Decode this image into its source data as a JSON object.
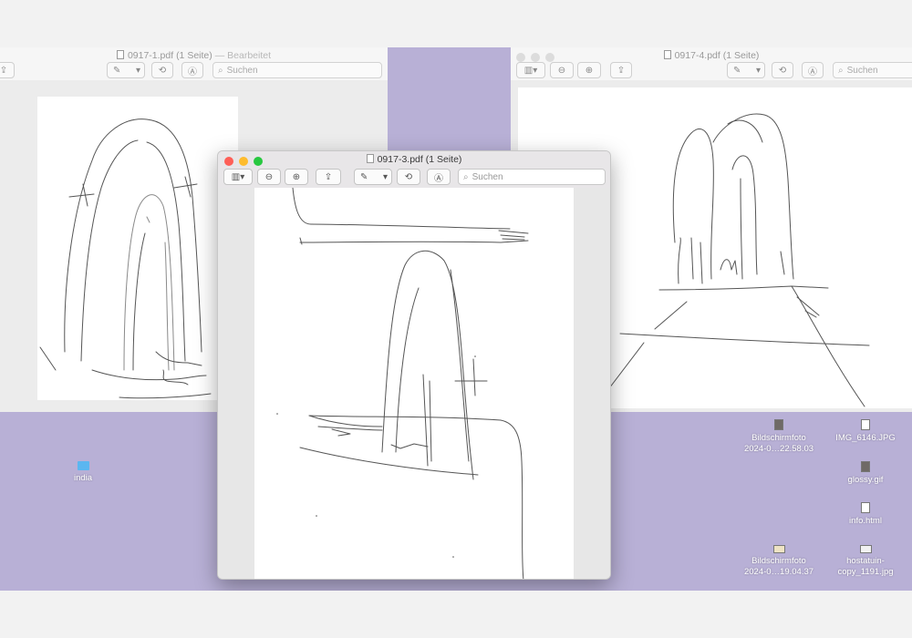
{
  "windows": {
    "left": {
      "title": "0917-1.pdf (1 Seite)",
      "title_suffix": "— Bearbeitet",
      "search_placeholder": "Suchen"
    },
    "right": {
      "title": "0917-4.pdf (1 Seite)",
      "search_placeholder": "Suchen"
    },
    "center": {
      "title": "0917-3.pdf (1 Seite)",
      "search_placeholder": "Suchen"
    }
  },
  "toolbar_icons": {
    "sidebar": "sidebar-icon",
    "zoom_out": "zoom-out-icon",
    "zoom_in": "zoom-in-icon",
    "share": "share-icon",
    "markup": "pen-icon",
    "rotate": "rotate-icon",
    "annotate": "markup-icon",
    "search": "magnifier-icon"
  },
  "desktop": {
    "background": "#b8b0d6",
    "icons": [
      {
        "name": "india",
        "kind": "folder"
      },
      {
        "name": "Bildschirmfoto\n2024-0…22.58.03",
        "line1": "Bildschirmfoto",
        "line2": "2024-0…22.58.03",
        "kind": "image"
      },
      {
        "name": "IMG_6146.JPG",
        "kind": "image"
      },
      {
        "name": "glossy.gif",
        "kind": "image"
      },
      {
        "name": "info.html",
        "kind": "file"
      },
      {
        "name": "Bildschirmfoto 2024-0…19.04.37",
        "line1": "Bildschirmfoto",
        "line2": "2024-0…19.04.37",
        "kind": "image"
      },
      {
        "name": "hostatuin-copy_1191.jpg",
        "line1": "hostatuin-",
        "line2": "copy_1191.jpg",
        "kind": "image"
      }
    ]
  },
  "colors": {
    "close": "#fe5f57",
    "minimize": "#febc2e",
    "maximize": "#28c840",
    "inactive_light": "#dcdcdc"
  }
}
